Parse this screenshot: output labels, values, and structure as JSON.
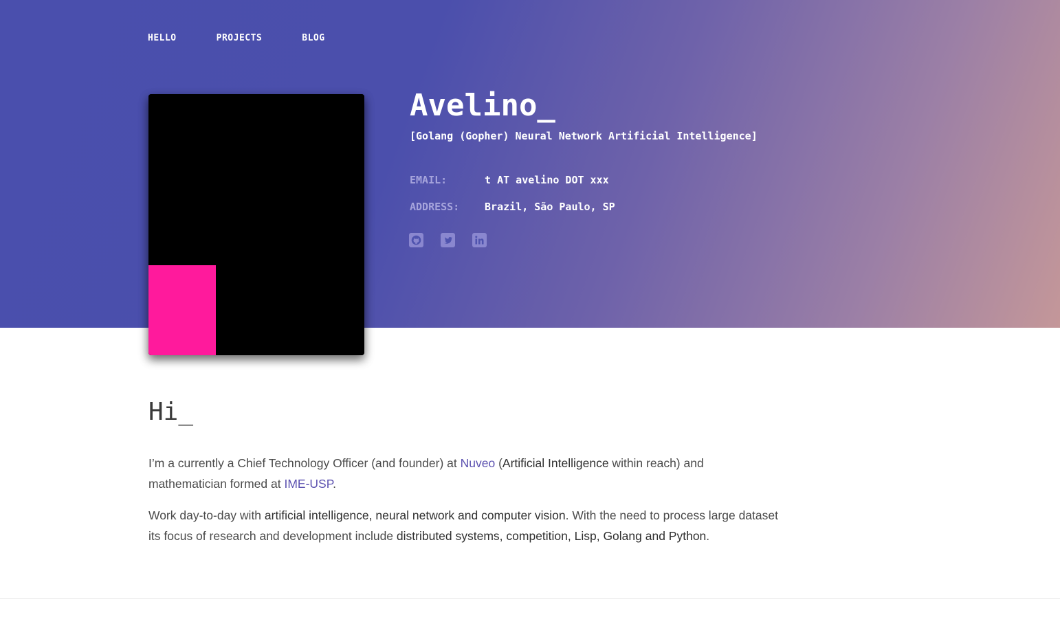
{
  "nav": {
    "items": [
      {
        "label": "HELLO"
      },
      {
        "label": "PROJECTS"
      },
      {
        "label": "BLOG"
      }
    ]
  },
  "profile": {
    "name": "Avelino_",
    "tagline": "[Golang (Gopher) Neural Network Artificial Intelligence]",
    "email_label": "EMAIL:",
    "email_value": "t AT avelino DOT xxx",
    "address_label": "ADDRESS:",
    "address_value": "Brazil, São Paulo, SP",
    "socials": [
      {
        "icon": "github-icon"
      },
      {
        "icon": "twitter-icon"
      },
      {
        "icon": "linkedin-icon"
      }
    ]
  },
  "about": {
    "heading": "Hi_",
    "p1": {
      "t1": "I’m a currently a Chief Technology Officer (and founder) at ",
      "link1": "Nuveo",
      "t2": " (",
      "b1": "Artificial Intelligence",
      "t3": " within reach) and mathematician formed at ",
      "link2": "IME-USP",
      "t4": "."
    },
    "p2": {
      "t1": "Work day-to-day with ",
      "b1": "artificial intelligence, neural network and computer vision",
      "t2": ". With the need to process large dataset its focus of research and development include ",
      "b2": "distributed systems, competition, Lisp, Golang and Python",
      "t3": "."
    }
  },
  "colors": {
    "accent_link": "#5c52b0",
    "photo_pink": "#ff1a9c",
    "hero_start": "#4a4fad",
    "hero_end": "#c49799"
  }
}
